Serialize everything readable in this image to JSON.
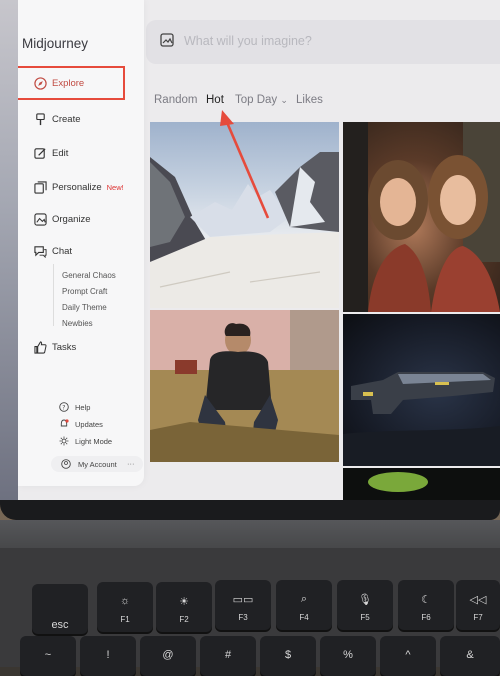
{
  "app": {
    "brand": "Midjourney"
  },
  "search": {
    "placeholder": "What will you imagine?",
    "icon": "image-icon"
  },
  "sidebar": {
    "items": [
      {
        "label": "Explore",
        "icon": "compass-icon",
        "active": true
      },
      {
        "label": "Create",
        "icon": "brush-icon"
      },
      {
        "label": "Edit",
        "icon": "edit-icon"
      },
      {
        "label": "Personalize",
        "icon": "personalize-icon",
        "badge": "New!"
      },
      {
        "label": "Organize",
        "icon": "folder-image-icon"
      },
      {
        "label": "Chat",
        "icon": "chat-icon"
      },
      {
        "label": "Tasks",
        "icon": "thumbs-up-icon"
      }
    ],
    "chat_rooms": [
      "General Chaos",
      "Prompt Craft",
      "Daily Theme",
      "Newbies"
    ],
    "footer": {
      "help": "Help",
      "updates": "Updates",
      "light_mode": "Light Mode",
      "account": "My Account",
      "account_menu": "···"
    }
  },
  "tabs": {
    "random": "Random",
    "hot": "Hot",
    "top_day": "Top Day",
    "likes": "Likes"
  },
  "keyboard": {
    "row": [
      {
        "top": "esc",
        "bottom": ""
      },
      {
        "top": "☼",
        "bottom": "F1"
      },
      {
        "top": "☀",
        "bottom": "F2"
      },
      {
        "top": "▭▭",
        "bottom": "F3"
      },
      {
        "top": "⌕",
        "bottom": "F4"
      },
      {
        "top": "🎙",
        "bottom": "F5"
      },
      {
        "top": "☾",
        "bottom": "F6"
      },
      {
        "top": "◁◁",
        "bottom": "F7"
      }
    ],
    "row2": [
      "~",
      "!",
      "@",
      "#",
      "$",
      "%",
      "^",
      "&"
    ]
  },
  "colors": {
    "accent": "#c14b42",
    "annotation": "#e64b3c"
  }
}
